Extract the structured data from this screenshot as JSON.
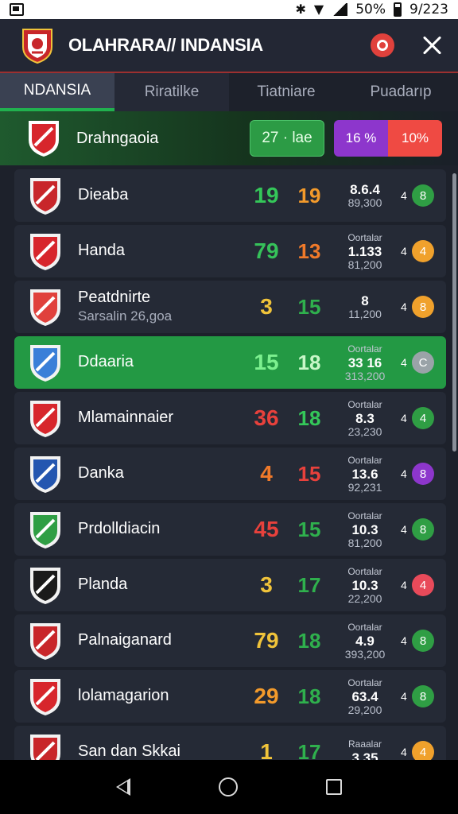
{
  "status_bar": {
    "battery_text": "50%",
    "time": "9/223",
    "icons": [
      "app-thumb-icon",
      "bluetooth-icon",
      "wifi-icon",
      "signal-icon",
      "battery-icon"
    ]
  },
  "app_bar": {
    "title": "OLAHRARA// INDANSIA",
    "logo_icon": "shield-crest-icon",
    "search_icon": "search-icon",
    "close_icon": "close-icon"
  },
  "tabs": [
    {
      "label": "NDANSIA",
      "active": true
    },
    {
      "label": "Riratilke",
      "active": false
    },
    {
      "label": "Tiatniare",
      "active": false
    },
    {
      "label": "Puadarıp",
      "active": false
    }
  ],
  "highlight": {
    "name": "Drahngaoia",
    "score": "27 · lae",
    "bar_left": "16 %",
    "bar_right": "10%",
    "colors": {
      "score": "#2c9b45",
      "left": "#8d36cc",
      "right": "#ef4a43"
    }
  },
  "rows": [
    {
      "name": "Dieaba",
      "sub": "",
      "v1": "19",
      "v1_color": "#34c759",
      "v2": "19",
      "v2_color": "#f39a2b",
      "stat_label": "",
      "stat_main": "8.6.4",
      "stat_sub": "89,300",
      "rank": "4",
      "dot": "8",
      "dot_color": "#2f9e44",
      "active": false
    },
    {
      "name": "Handa",
      "sub": "",
      "v1": "79",
      "v1_color": "#36c25a",
      "v2": "13",
      "v2_color": "#f07a2a",
      "stat_label": "Oortalar",
      "stat_main": "1.133",
      "stat_sub": "81,200",
      "rank": "4",
      "dot": "4",
      "dot_color": "#f0a12c",
      "active": false
    },
    {
      "name": "Peatdnirte",
      "sub": "Sarsalin 26,goa",
      "v1": "3",
      "v1_color": "#f0c33a",
      "v2": "15",
      "v2_color": "#2fb04d",
      "stat_label": "",
      "stat_main": "8",
      "stat_sub": "11,200",
      "rank": "4",
      "dot": "8",
      "dot_color": "#f0a12c",
      "active": false
    },
    {
      "name": "Ddaaria",
      "sub": "",
      "v1": "15",
      "v1_color": "#7cf08f",
      "v2": "18",
      "v2_color": "#c8f7c8",
      "stat_label": "Oortalar",
      "stat_main": "33 16",
      "stat_sub": "313,200",
      "rank": "4",
      "dot": "C",
      "dot_color": "#9aa3a8",
      "active": true
    },
    {
      "name": "Mlamainnaier",
      "sub": "",
      "v1": "36",
      "v1_color": "#e8413c",
      "v2": "18",
      "v2_color": "#34c759",
      "stat_label": "Oortalar",
      "stat_main": "8.3",
      "stat_sub": "23,230",
      "rank": "4",
      "dot": "4",
      "dot_color": "#2f9e44",
      "active": false
    },
    {
      "name": "Danka",
      "sub": "",
      "v1": "4",
      "v1_color": "#f07a2a",
      "v2": "15",
      "v2_color": "#e8413c",
      "stat_label": "Oortalar",
      "stat_main": "13.6",
      "stat_sub": "92,231",
      "rank": "4",
      "dot": "8",
      "dot_color": "#8d36cc",
      "active": false
    },
    {
      "name": "Prdolldiacin",
      "sub": "",
      "v1": "45",
      "v1_color": "#e8413c",
      "v2": "15",
      "v2_color": "#2fb04d",
      "stat_label": "Oortalar",
      "stat_main": "10.3",
      "stat_sub": "81,200",
      "rank": "4",
      "dot": "8",
      "dot_color": "#2f9e44",
      "active": false
    },
    {
      "name": "Planda",
      "sub": "",
      "v1": "3",
      "v1_color": "#f0c33a",
      "v2": "17",
      "v2_color": "#2fb04d",
      "stat_label": "Oortalar",
      "stat_main": "10.3",
      "stat_sub": "22,200",
      "rank": "4",
      "dot": "4",
      "dot_color": "#e84a5a",
      "active": false
    },
    {
      "name": "Palnaiganard",
      "sub": "",
      "v1": "79",
      "v1_color": "#f0c33a",
      "v2": "18",
      "v2_color": "#2fb04d",
      "stat_label": "Oortalar",
      "stat_main": "4.9",
      "stat_sub": "393,200",
      "rank": "4",
      "dot": "8",
      "dot_color": "#2f9e44",
      "active": false
    },
    {
      "name": "lolamagarion",
      "sub": "",
      "v1": "29",
      "v1_color": "#f39a2b",
      "v2": "18",
      "v2_color": "#2fb04d",
      "stat_label": "Oortalar",
      "stat_main": "63.4",
      "stat_sub": "29,200",
      "rank": "4",
      "dot": "8",
      "dot_color": "#2f9e44",
      "active": false
    },
    {
      "name": "San dan Skkai",
      "sub": "",
      "v1": "1",
      "v1_color": "#f0c33a",
      "v2": "17",
      "v2_color": "#2fb04d",
      "stat_label": "Raaalar",
      "stat_main": "3.35",
      "stat_sub": "",
      "rank": "4",
      "dot": "4",
      "dot_color": "#f0a12c",
      "active": false
    }
  ],
  "nav": {
    "back_icon": "back-triangle-icon",
    "home_icon": "home-circle-icon",
    "recents_icon": "recents-square-icon"
  }
}
